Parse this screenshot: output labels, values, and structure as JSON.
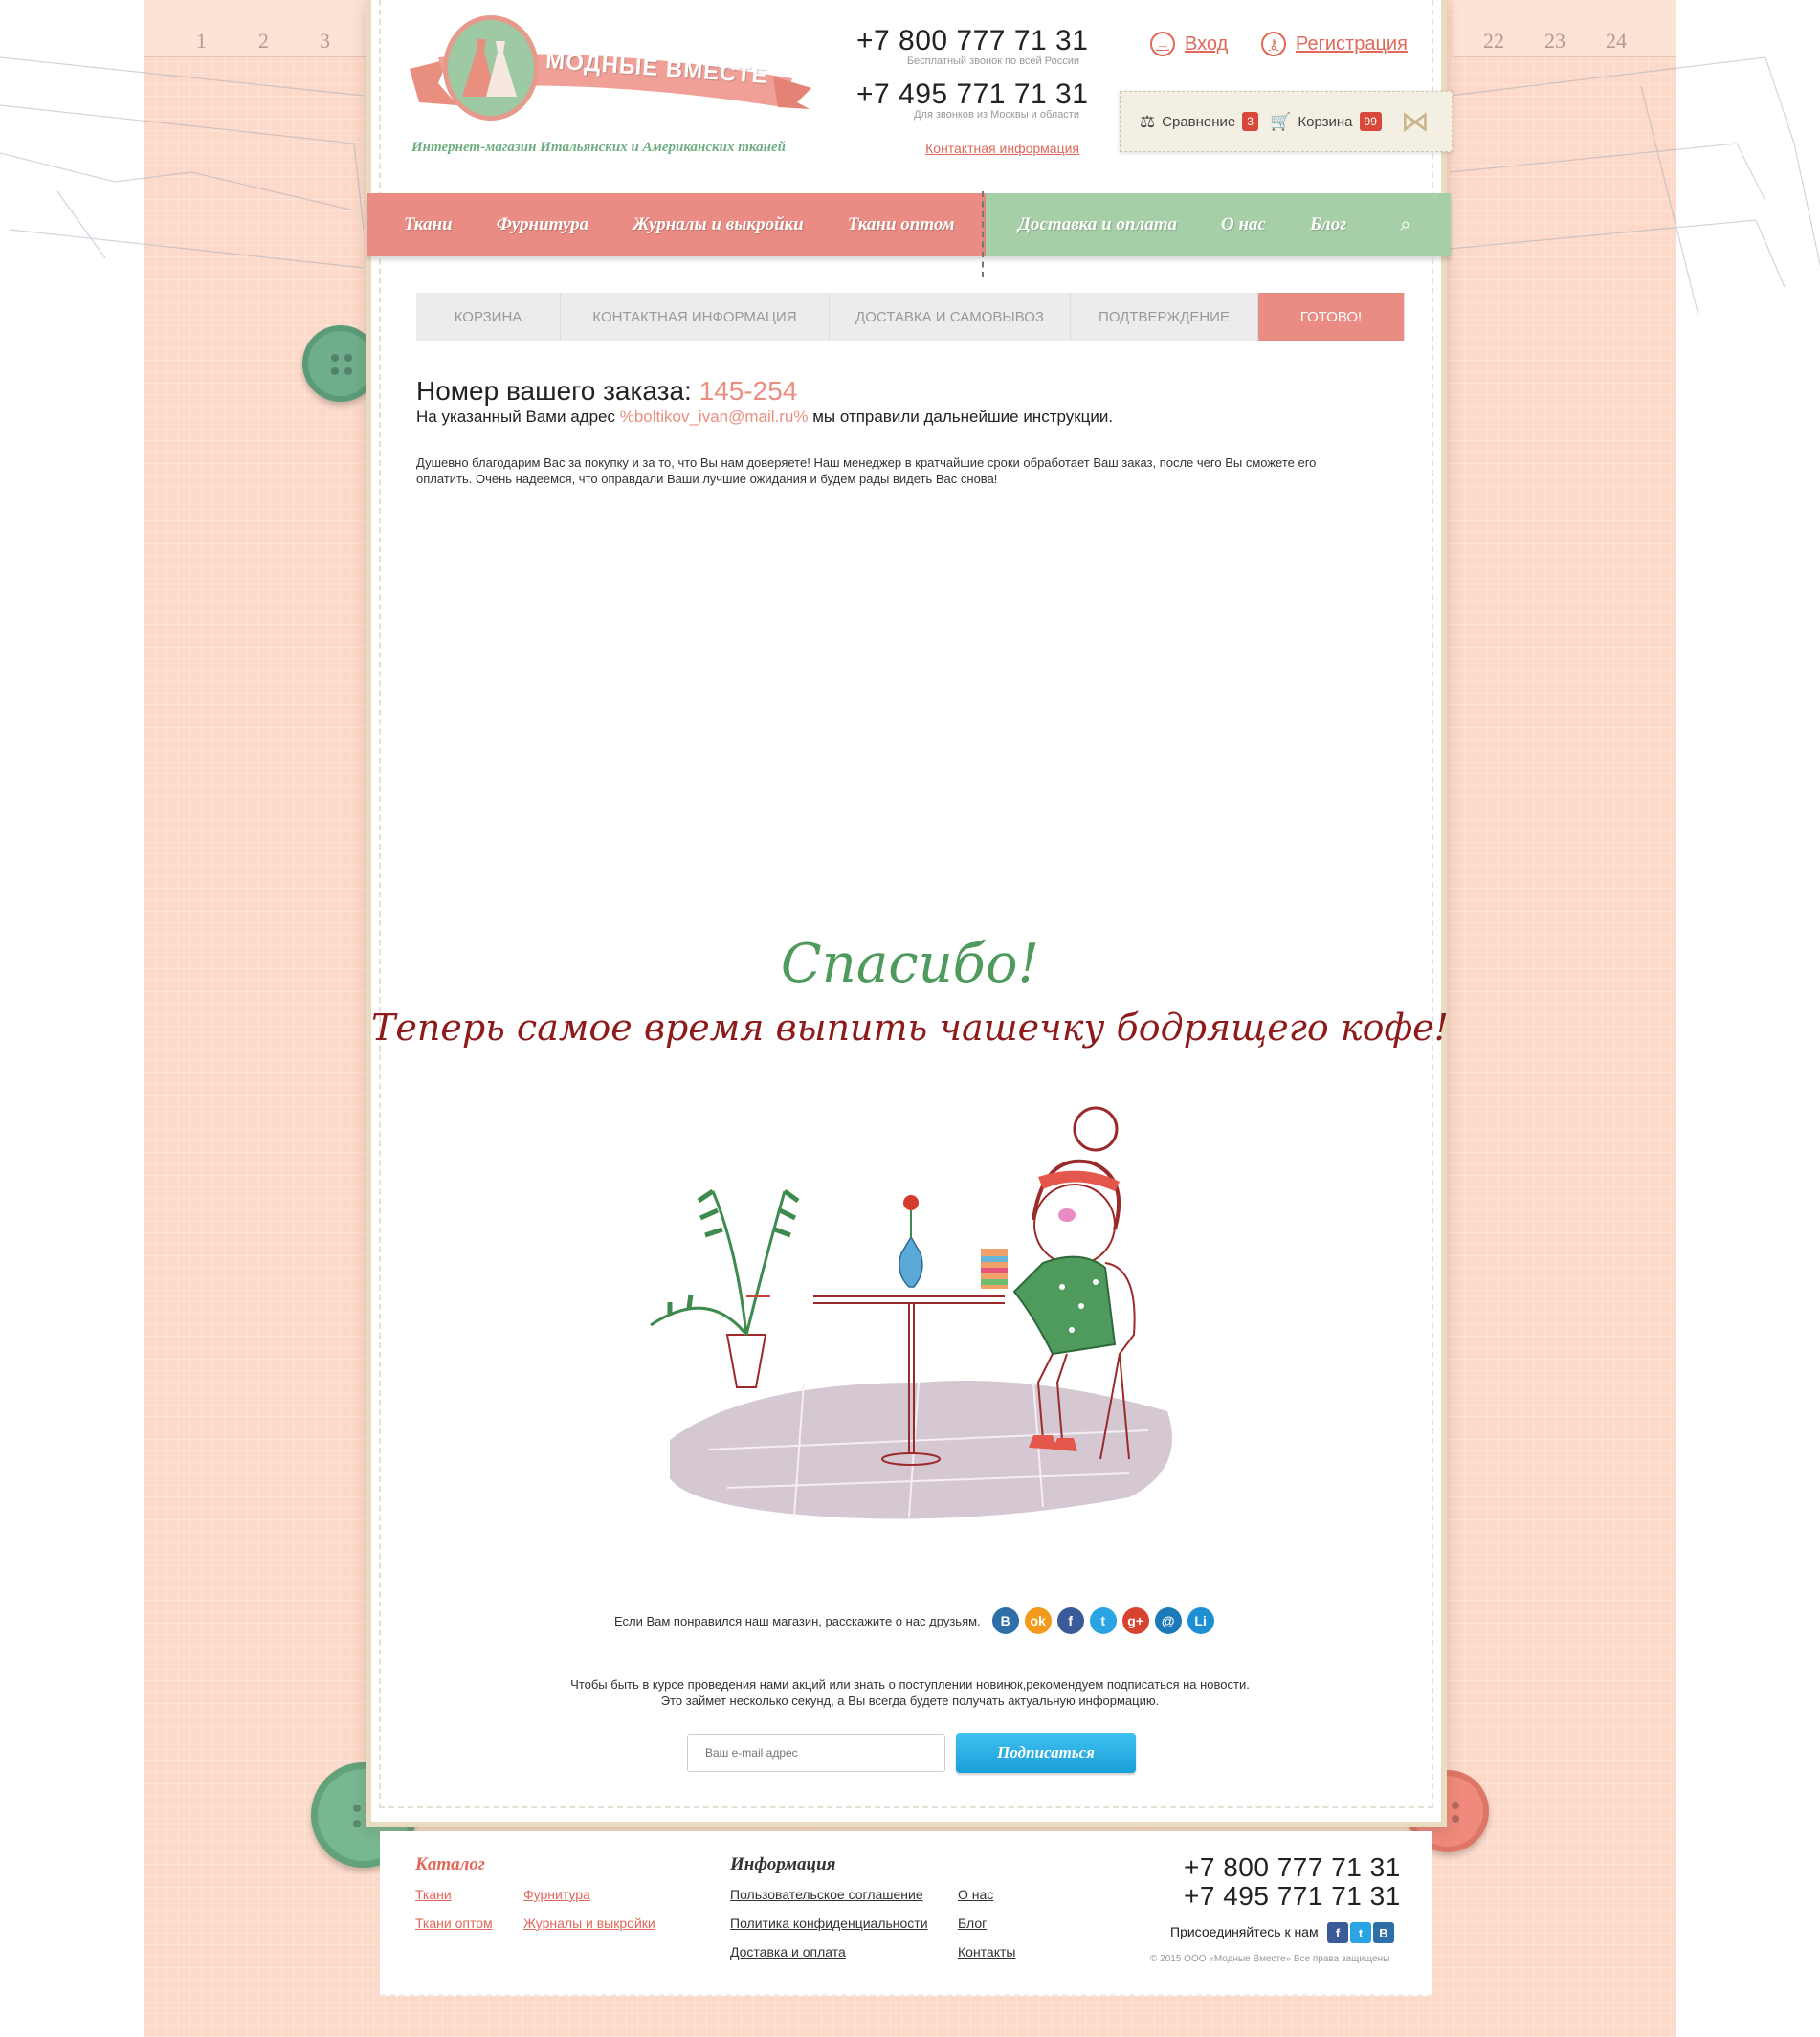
{
  "header": {
    "logo_name": "МОДНЫЕ ВМЕСТЕ",
    "tagline": "Интернет-магазин Итальянских и Американских тканей",
    "phone1": "+7 800 777 71 31",
    "phone1_note": "Бесплатный звонок по всей России",
    "phone2": "+7 495 771 71 31",
    "phone2_note": "Для звонков из Москвы и области",
    "contact_link": "Контактная информация",
    "login": "Вход",
    "register": "Регистрация",
    "compare_label": "Сравнение",
    "compare_count": "3",
    "cart_label": "Корзина",
    "cart_count": "99"
  },
  "nav": {
    "left": [
      "Ткани",
      "Фурнитура",
      "Журналы и выкройки",
      "Ткани оптом"
    ],
    "right": [
      "Доставка и оплата",
      "О нас",
      "Блог"
    ]
  },
  "steps": [
    "КОРЗИНА",
    "КОНТАКТНАЯ ИНФОРМАЦИЯ",
    "ДОСТАВКА И САМОВЫВОЗ",
    "ПОДТВЕРЖДЕНИЕ",
    "ГОТОВО!"
  ],
  "order": {
    "title": "Номер вашего заказа:",
    "number": "145-254",
    "sub_prefix": "На указанный Вами адрес",
    "email": "%boltikov_ivan@mail.ru%",
    "sub_suffix": "мы отправили дальнейшие инструкции.",
    "thanks_text": "Душевно благодарим Вас за покупку и за то, что Вы нам доверяете!  Наш менеджер в кратчайшие сроки обработает Ваш заказ, после чего Вы сможете его оплатить. Очень надеемся, что оправдали Ваши лучшие ожидания и будем рады видеть Вас снова!"
  },
  "thanks": {
    "title": "Спасибо!",
    "subtitle": "Теперь самое время выпить чашечку бодрящего кофе!"
  },
  "share": {
    "text": "Если Вам понравился наш магазин, расскажите о нас друзьям.",
    "icons": [
      {
        "name": "vk-icon",
        "glyph": "B",
        "color": "#2f6fa8"
      },
      {
        "name": "odnoklassniki-icon",
        "glyph": "ok",
        "color": "#f29a1c"
      },
      {
        "name": "facebook-icon",
        "glyph": "f",
        "color": "#3b5a9a"
      },
      {
        "name": "twitter-icon",
        "glyph": "t",
        "color": "#2aa4e2"
      },
      {
        "name": "google-plus-icon",
        "glyph": "g+",
        "color": "#d8432f"
      },
      {
        "name": "mailru-icon",
        "glyph": "@",
        "color": "#1d7ab9"
      },
      {
        "name": "liveinternet-icon",
        "glyph": "Li",
        "color": "#1f8fd4"
      }
    ]
  },
  "subscribe": {
    "line1": "Чтобы быть в курсе проведения нами акций или знать о поступлении новинок,рекомендуем подписаться на новости.",
    "line2": "Это займет несколько секунд, а Вы всегда будете получать актуальную информацию.",
    "placeholder": "Ваш e-mail адрес",
    "button": "Подписаться"
  },
  "footer": {
    "catalog_title": "Каталог",
    "catalog_links": [
      "Ткани",
      "Фурнитура",
      "Ткани оптом",
      "Журналы и выкройки"
    ],
    "info_title": "Информация",
    "info_links": [
      "Пользовательское соглашение",
      "О нас",
      "Политика конфиденциальности",
      "Блог",
      "Доставка и оплата",
      "Контакты"
    ],
    "phone1": "+7 800 777 71 31",
    "phone2": "+7 495 771 71 31",
    "join": "Присоединяйтесь к нам",
    "copyright": "© 2015 ООО «Модные Вместе» Все права защищены"
  },
  "ruler": [
    "1",
    "2",
    "3",
    "22",
    "23",
    "24"
  ],
  "colors": {
    "accent_red": "#ea8c83",
    "accent_green": "#a6cfa7",
    "link_red": "#e0675a"
  }
}
